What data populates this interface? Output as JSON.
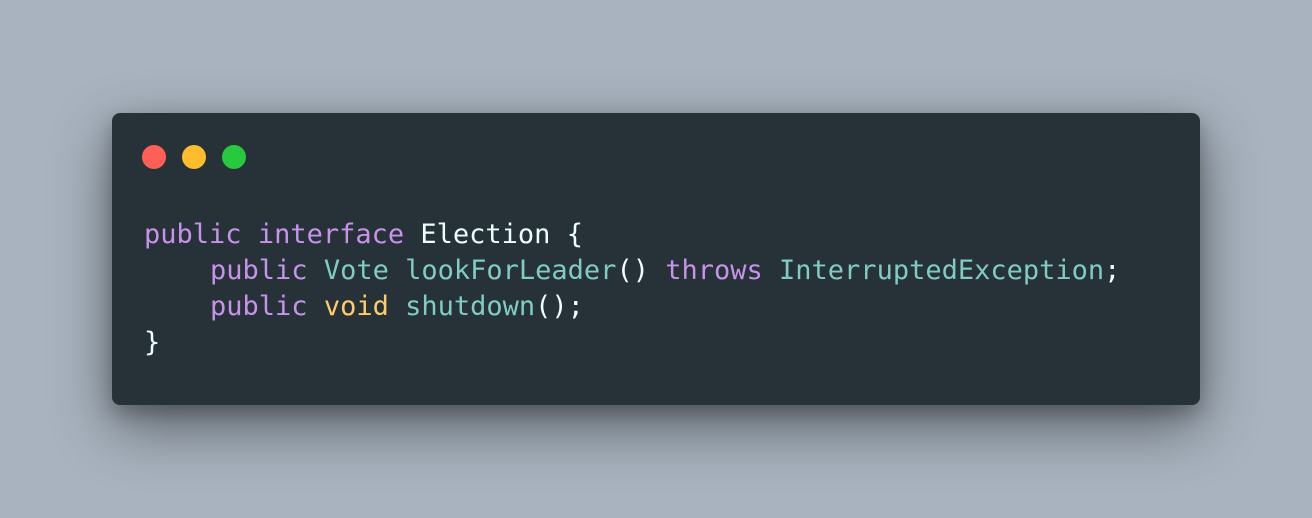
{
  "colors": {
    "background": "#a8b3bf",
    "window": "#263238",
    "close": "#ff5f56",
    "minimize": "#ffbd2e",
    "maximize": "#27c93f",
    "keyword": "#c792ea",
    "type": "#80cbc4",
    "void": "#ffcb6b",
    "plain": "#eeffff",
    "punct": "#89ddff"
  },
  "window_controls": [
    "close-dot",
    "minimize-dot",
    "maximize-dot"
  ],
  "code": {
    "lines": [
      [
        {
          "text": "public",
          "kind": "keyword"
        },
        {
          "text": " ",
          "kind": "plain"
        },
        {
          "text": "interface",
          "kind": "keyword"
        },
        {
          "text": " ",
          "kind": "plain"
        },
        {
          "text": "Election",
          "kind": "plain"
        },
        {
          "text": " {",
          "kind": "plain"
        }
      ],
      [
        {
          "text": "public",
          "kind": "keyword"
        },
        {
          "text": " ",
          "kind": "plain"
        },
        {
          "text": "Vote",
          "kind": "type"
        },
        {
          "text": " ",
          "kind": "plain"
        },
        {
          "text": "lookForLeader",
          "kind": "type"
        },
        {
          "text": "()",
          "kind": "plain"
        },
        {
          "text": " ",
          "kind": "plain"
        },
        {
          "text": "throws",
          "kind": "keyword"
        },
        {
          "text": " ",
          "kind": "plain"
        },
        {
          "text": "InterruptedException",
          "kind": "type"
        },
        {
          "text": ";",
          "kind": "plain"
        }
      ],
      [
        {
          "text": "public",
          "kind": "keyword"
        },
        {
          "text": " ",
          "kind": "plain"
        },
        {
          "text": "void",
          "kind": "void"
        },
        {
          "text": " ",
          "kind": "plain"
        },
        {
          "text": "shutdown",
          "kind": "type"
        },
        {
          "text": "();",
          "kind": "plain"
        }
      ],
      [
        {
          "text": "}",
          "kind": "plain"
        }
      ]
    ]
  }
}
